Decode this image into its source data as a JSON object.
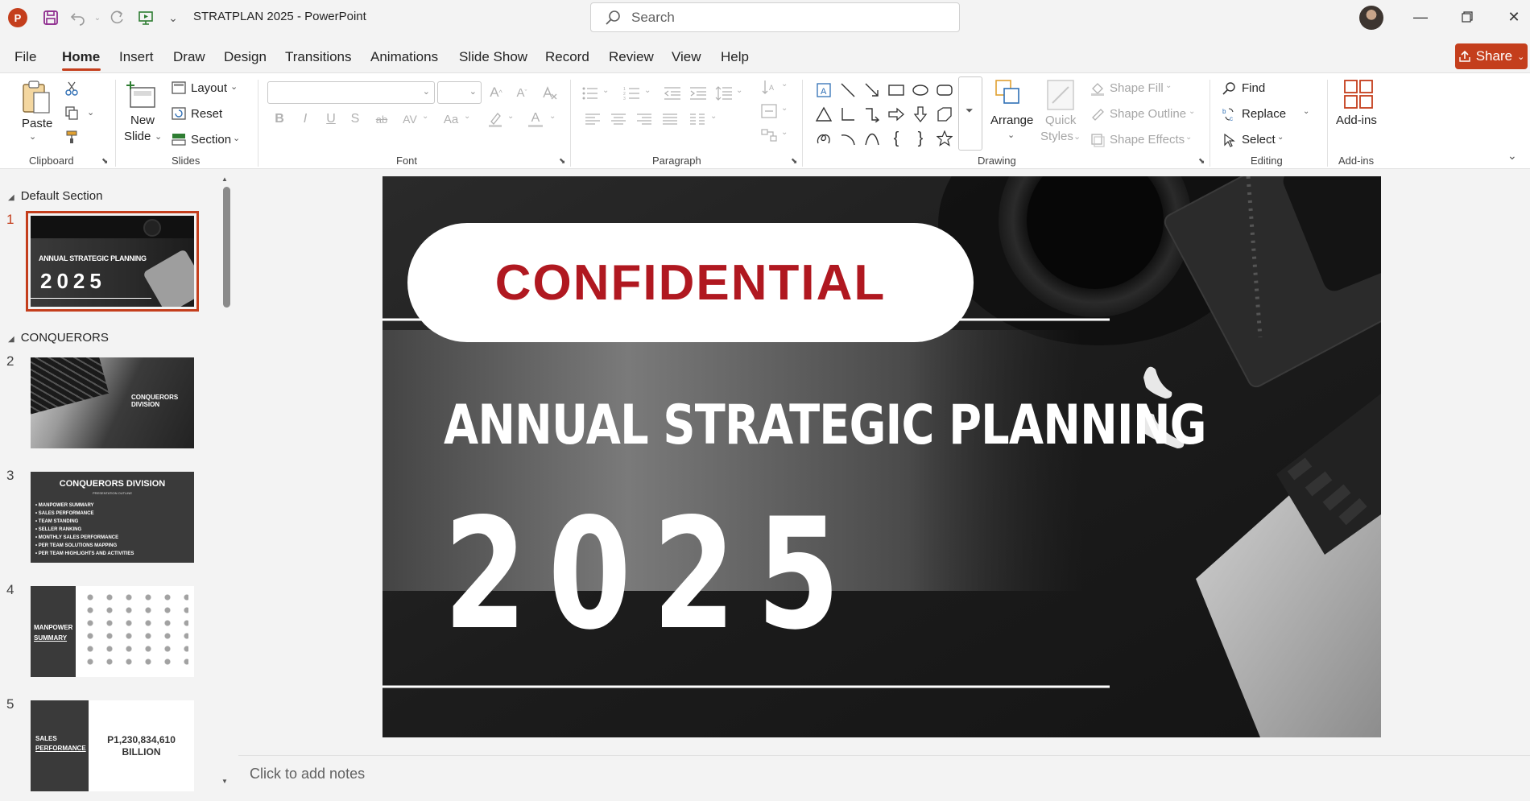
{
  "titlebar": {
    "app_icon_letter": "P",
    "title": "STRATPLAN 2025  -  PowerPoint",
    "search_placeholder": "Search"
  },
  "menu": {
    "items": [
      "File",
      "Home",
      "Insert",
      "Draw",
      "Design",
      "Transitions",
      "Animations",
      "Slide Show",
      "Record",
      "Review",
      "View",
      "Help"
    ],
    "active": "Home",
    "share_label": "Share"
  },
  "ribbon": {
    "clipboard": {
      "paste": "Paste",
      "group": "Clipboard"
    },
    "slides": {
      "new_slide_line1": "New",
      "new_slide_line2": "Slide",
      "layout": "Layout",
      "reset": "Reset",
      "section": "Section",
      "group": "Slides"
    },
    "font": {
      "group": "Font",
      "bold": "B",
      "italic": "I",
      "underline": "U",
      "shadow": "S",
      "strike": "ab",
      "spacing": "AV",
      "case": "Aa",
      "color": "A"
    },
    "paragraph": {
      "group": "Paragraph"
    },
    "drawing": {
      "arrange": "Arrange",
      "quick_styles_line1": "Quick",
      "quick_styles_line2": "Styles",
      "shape_fill": "Shape Fill",
      "shape_outline": "Shape Outline",
      "shape_effects": "Shape Effects",
      "group": "Drawing"
    },
    "editing": {
      "find": "Find",
      "replace": "Replace",
      "select": "Select",
      "group": "Editing"
    },
    "addins": {
      "label": "Add-ins",
      "group": "Add-ins"
    }
  },
  "slide_panel": {
    "sections": [
      "Default Section",
      "CONQUERORS"
    ],
    "slides": [
      {
        "number": "1",
        "title": "ANNUAL STRATEGIC PLANNING",
        "year": "2025"
      },
      {
        "number": "2",
        "title": "CONQUERORS DIVISION"
      },
      {
        "number": "3",
        "title": "CONQUERORS DIVISION",
        "subtitle": "PRESENTATION OUTLINE",
        "bullets": [
          "MANPOWER SUMMARY",
          "SALES PERFORMANCE",
          "TEAM STANDING",
          "SELLER RANKING",
          "MONTHLY SALES PERFORMANCE",
          "PER TEAM SOLUTIONS MAPPING",
          "PER TEAM HIGHLIGHTS AND ACTIVITIES"
        ]
      },
      {
        "number": "4",
        "title_line1": "MANPOWER",
        "title_line2": "SUMMARY"
      },
      {
        "number": "5",
        "title_line1": "SALES",
        "title_line2": "PERFORMANCE",
        "value_line1": "P1,230,834,610",
        "value_line2": "BILLION"
      }
    ]
  },
  "main_slide": {
    "badge": "CONFIDENTIAL",
    "title": "ANNUAL STRATEGIC PLANNING",
    "year": "2025"
  },
  "notes": {
    "placeholder": "Click to add notes"
  },
  "colors": {
    "accent": "#c43e1c",
    "confidential_red": "#b01820"
  }
}
